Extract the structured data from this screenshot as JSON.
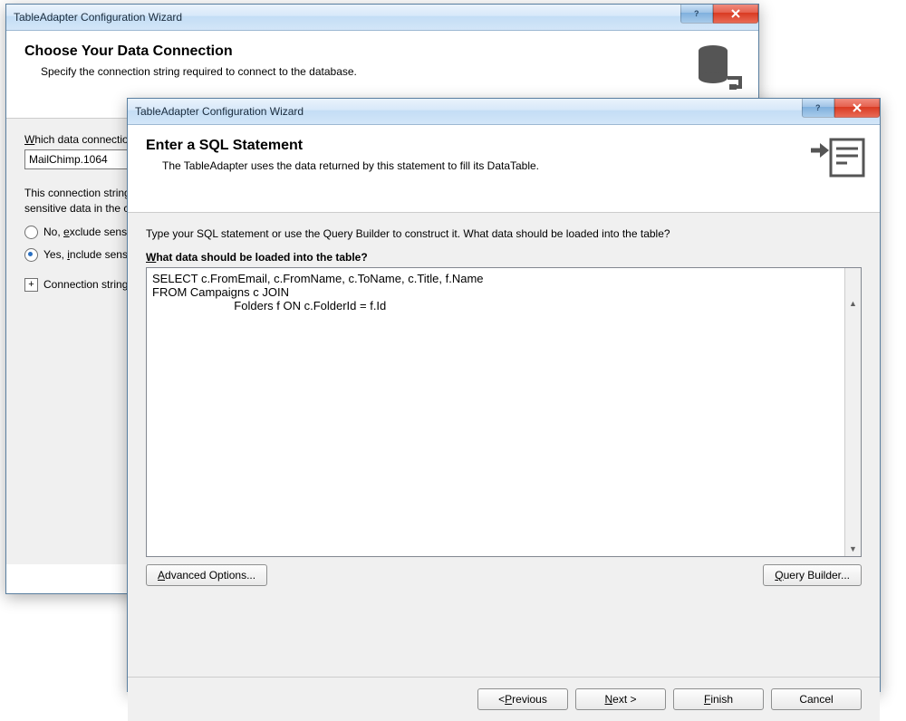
{
  "back": {
    "title": "TableAdapter Configuration Wizard",
    "heading": "Choose Your Data Connection",
    "subheading": "Specify the connection string required to connect to the database.",
    "connection_label": "Which data connection should your application use to connect to the database?",
    "connection_value": "MailChimp.1064",
    "para": "This connection string appears to contain sensitive data (for example, a password), which is required to connect to the database. However, storing sensitive data in the connection string can be a security risk. Do you want to include this sensitive data in the connection string?",
    "radio_no": "No, exclude sensitive data from the connection string. I will set this information in my application code.",
    "radio_yes": "Yes, include sensitive data in the connection string.",
    "expand_label": "Connection string that you will save in the application"
  },
  "front": {
    "title": "TableAdapter Configuration Wizard",
    "heading": "Enter a SQL Statement",
    "subheading": "The TableAdapter uses the data returned by this statement to fill its DataTable.",
    "instruction": "Type your SQL statement or use the Query Builder to construct it. What data should be loaded into the table?",
    "question": "What data should be loaded into the table?",
    "sql": "SELECT c.FromEmail, c.FromName, c.ToName, c.Title, f.Name\nFROM Campaigns c JOIN\n                         Folders f ON c.FolderId = f.Id",
    "advanced_btn": "Advanced Options...",
    "querybuilder_btn": "Query Builder...",
    "prev_btn": "< Previous",
    "next_btn": "Next >",
    "finish_btn": "Finish",
    "cancel_btn": "Cancel"
  }
}
